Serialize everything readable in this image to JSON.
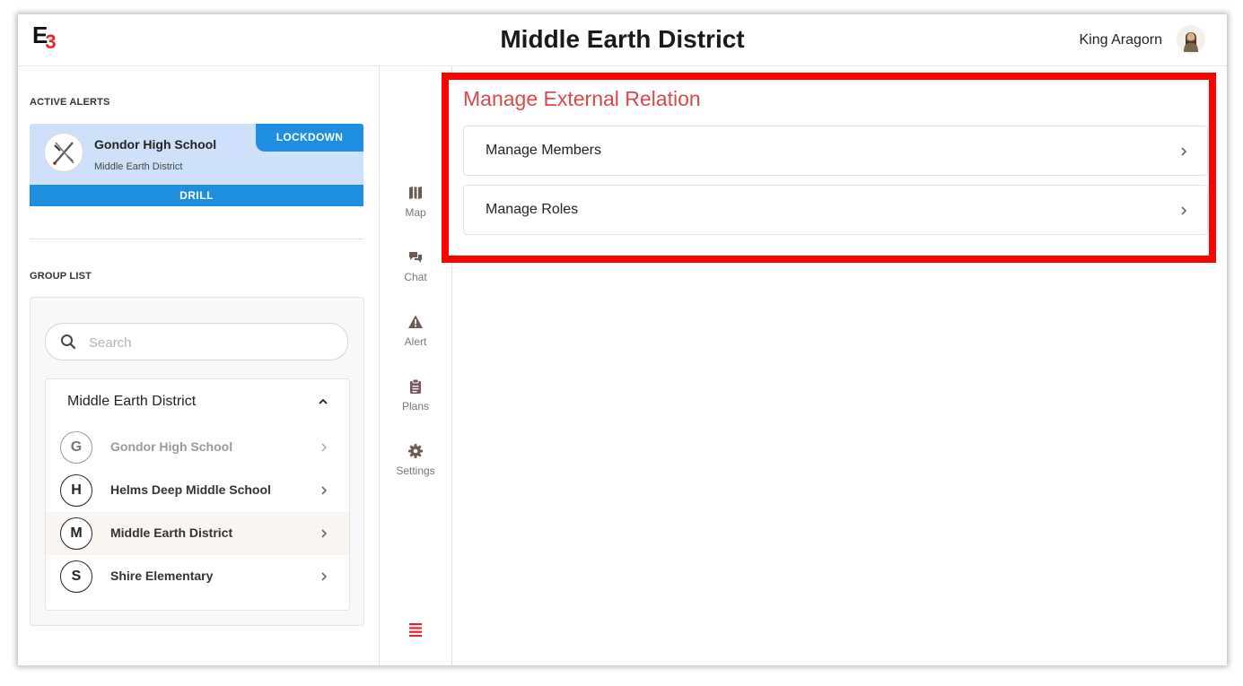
{
  "header": {
    "logo_text": "E",
    "logo_accent": "3",
    "title": "Middle Earth District",
    "user_name": "King Aragorn"
  },
  "sidebar": {
    "active_alerts_label": "ACTIVE ALERTS",
    "alert": {
      "school": "Gondor High School",
      "district": "Middle Earth District",
      "badge": "LOCKDOWN",
      "type": "DRILL"
    },
    "group_list_label": "GROUP LIST",
    "search_placeholder": "Search",
    "district": {
      "name": "Middle Earth District",
      "schools": [
        {
          "initial": "G",
          "name": "Gondor High School"
        },
        {
          "initial": "H",
          "name": "Helms Deep Middle School"
        },
        {
          "initial": "M",
          "name": "Middle Earth District"
        },
        {
          "initial": "S",
          "name": "Shire Elementary"
        }
      ]
    }
  },
  "nav": {
    "items": [
      {
        "label": "Map",
        "icon": "map-icon"
      },
      {
        "label": "Chat",
        "icon": "chat-icon"
      },
      {
        "label": "Alert",
        "icon": "alert-icon"
      },
      {
        "label": "Plans",
        "icon": "clipboard-icon"
      },
      {
        "label": "Settings",
        "icon": "gear-icon"
      }
    ],
    "menu_icon": "hamburger-menu-icon"
  },
  "main": {
    "title": "Manage External Relation",
    "options": [
      {
        "label": "Manage Members"
      },
      {
        "label": "Manage Roles"
      }
    ]
  },
  "colors": {
    "brand_red": "#e0262b",
    "title_red": "#d84a4a",
    "alert_blue": "#1e8fe0",
    "alert_bg": "#cfe1fa",
    "highlight": "#ff0000",
    "nav_icon": "#6f5a55"
  }
}
